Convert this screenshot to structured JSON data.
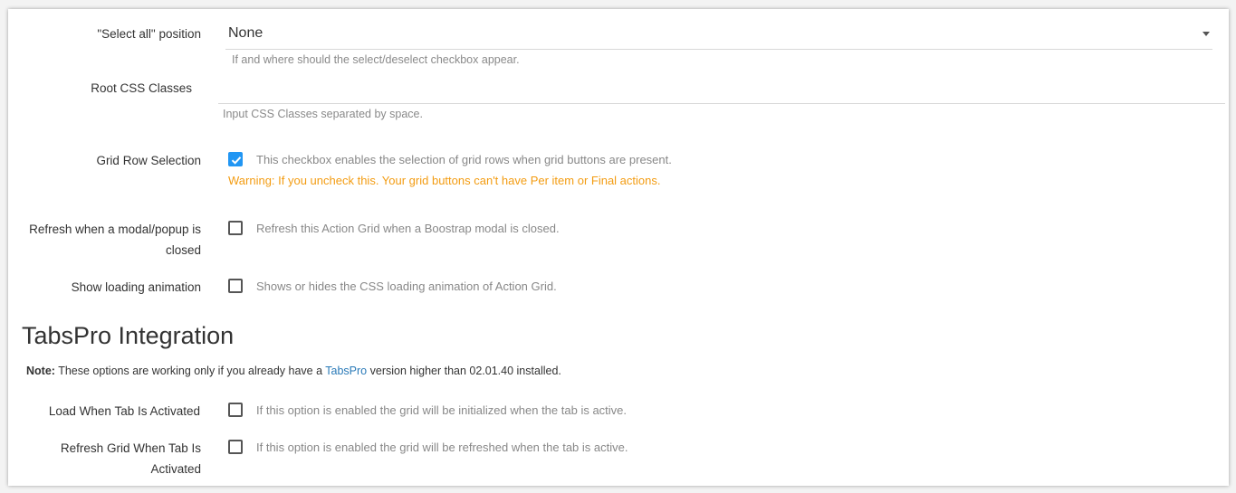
{
  "select_all": {
    "label": "\"Select all\" position",
    "value": "None",
    "help": "If and where should the select/deselect checkbox appear."
  },
  "root_css": {
    "label": "Root CSS Classes",
    "value": "",
    "help": "Input CSS Classes separated by space."
  },
  "grid_row_selection": {
    "label": "Grid Row Selection",
    "checked": true,
    "description": "This checkbox enables the selection of grid rows when grid buttons are present.",
    "warning": "Warning: If you uncheck this. Your grid buttons can't have Per item or Final actions."
  },
  "refresh_modal": {
    "label_line1": "Refresh when a modal/popup is",
    "label_line2": "closed",
    "checked": false,
    "description": "Refresh this Action Grid when a Boostrap modal is closed."
  },
  "loading_animation": {
    "label": "Show loading animation",
    "checked": false,
    "description": "Shows or hides the CSS loading animation of Action Grid."
  },
  "tabspro": {
    "title": "TabsPro Integration",
    "note_bold": "Note:",
    "note_pre": " These options are working only if you already have a ",
    "note_link": "TabsPro",
    "note_post": " version higher than 02.01.40 installed."
  },
  "load_tab": {
    "label": "Load When Tab Is Activated",
    "checked": false,
    "description": "If this option is enabled the grid will be initialized when the tab is active."
  },
  "refresh_tab": {
    "label_line1": "Refresh Grid When Tab Is",
    "label_line2": "Activated",
    "checked": false,
    "description": "If this option is enabled the grid will be refreshed when the tab is active."
  },
  "colors": {
    "accent": "#2196f3",
    "warning": "#f39c12",
    "link": "#2a7ab8"
  }
}
